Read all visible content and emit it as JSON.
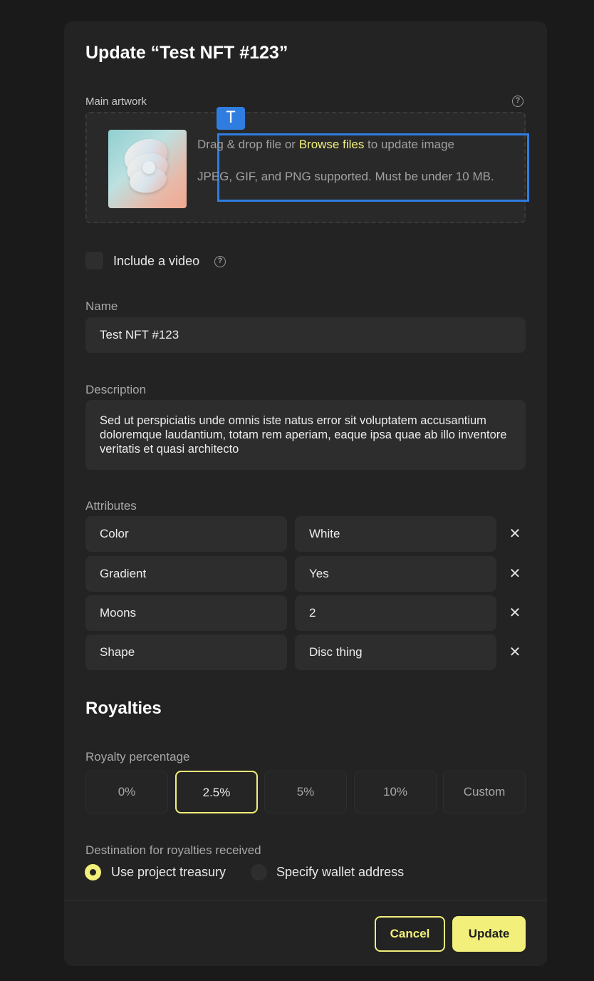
{
  "modal": {
    "title": "Update “Test NFT #123”"
  },
  "artwork": {
    "label": "Main artwork",
    "drag_text": "Drag & drop file or ",
    "browse_link": "Browse files",
    "drag_suffix": " to update image",
    "supported_text": "JPEG, GIF, and PNG supported. Must be under 10 MB.",
    "text_tool_glyph": "T"
  },
  "video": {
    "checkbox_label": "Include a video",
    "checked": false
  },
  "name": {
    "label": "Name",
    "value": "Test NFT #123"
  },
  "description": {
    "label": "Description",
    "value": "Sed ut perspiciatis unde omnis iste natus error sit voluptatem accusantium doloremque laudantium, totam rem aperiam, eaque ipsa quae ab illo inventore veritatis et quasi architecto"
  },
  "attributes": {
    "label": "Attributes",
    "remove_glyph": "✕",
    "items": [
      {
        "key": "Color",
        "value": "White"
      },
      {
        "key": "Gradient",
        "value": "Yes"
      },
      {
        "key": "Moons",
        "value": "2"
      },
      {
        "key": "Shape",
        "value": "Disc thing"
      }
    ]
  },
  "royalties": {
    "title": "Royalties",
    "percentage_label": "Royalty percentage",
    "options": [
      "0%",
      "2.5%",
      "5%",
      "10%",
      "Custom"
    ],
    "selected": "2.5%",
    "destination_label": "Destination for royalties received",
    "destination_options": [
      "Use project treasury",
      "Specify wallet address"
    ],
    "destination_selected": "Use project treasury"
  },
  "footer": {
    "cancel_label": "Cancel",
    "update_label": "Update"
  },
  "colors": {
    "accent": "#f2ef7a",
    "background": "#1a1a1a",
    "panel": "#232323",
    "field": "#2d2d2d",
    "selection": "#2f7de0"
  }
}
